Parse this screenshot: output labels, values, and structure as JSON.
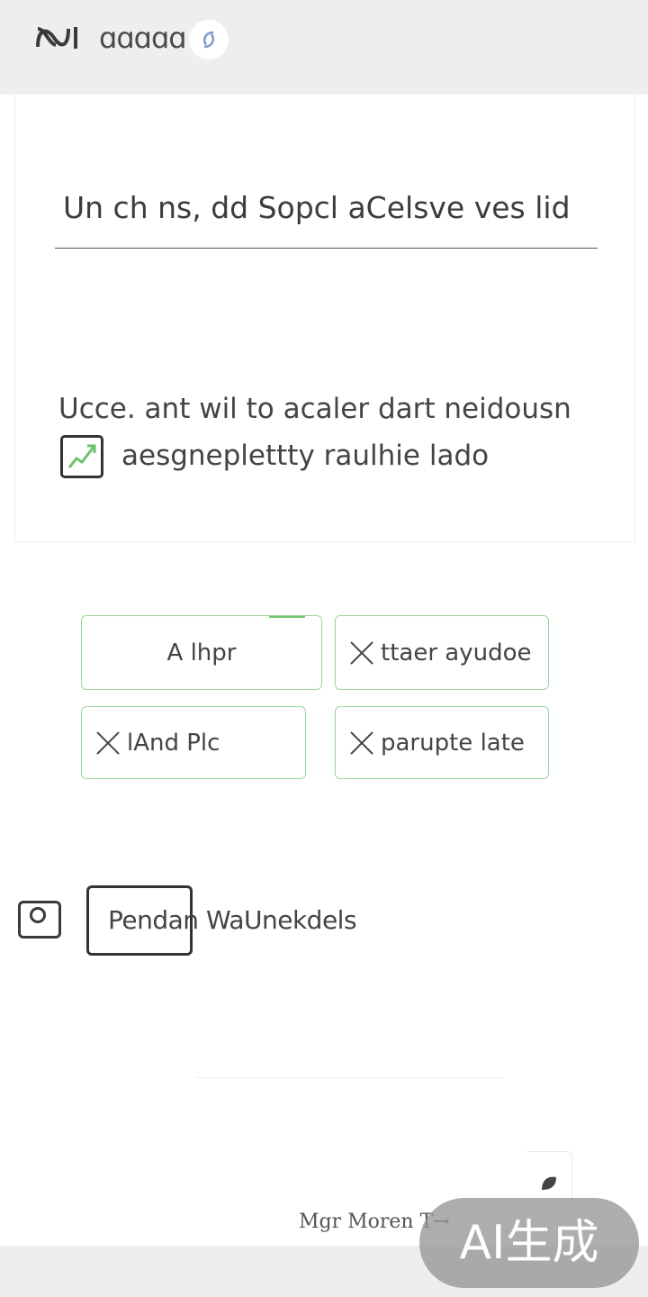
{
  "header": {
    "title": "ᱭ",
    "app_name": "ɑɑɑɑɑ",
    "logo_icon": "infinity-logo-icon",
    "sync_icon": "sync-icon"
  },
  "card": {
    "headline": "Un ch ns, dd Sopcl aCelsve ves lid",
    "description_line1": "Ucce. ant wil to acaler dart neidousn",
    "description_line2": "aesgneplettty raulhie lado",
    "checkbox_icon": "trend-checkbox-icon"
  },
  "chips": [
    {
      "label": "A lhpr",
      "removable": false
    },
    {
      "label": "ttaer ayudoe",
      "removable": true
    },
    {
      "label": "lAnd Plc",
      "removable": true
    },
    {
      "label": "parupte late",
      "removable": true
    }
  ],
  "pending": {
    "label": "Pendan WaUnekdels",
    "icon": "camera-icon"
  },
  "footer": {
    "more_link": "Mgr Moren T→",
    "corner_icon": "leaf-icon",
    "watermark": "AI生成"
  },
  "colors": {
    "chip_border": "#9ad69a",
    "accent_green": "#72c872",
    "bar_gray": "#eeeeee"
  }
}
